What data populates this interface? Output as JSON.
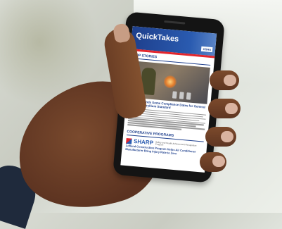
{
  "newsletter": {
    "brand": "QuickTakes",
    "org": "OSHA",
    "colors": {
      "brand_blue": "#1e3f8c",
      "accent_red": "#e3262d"
    }
  },
  "sections": {
    "top_stories": "TOP STORIES",
    "cooperative": "COOPERATIVE PROGRAMS"
  },
  "story1": {
    "title": "OSHA Extends Some Compliance Dates for General Industry Beryllium Standard"
  },
  "sharp": {
    "logo": "SHARP",
    "tagline": "Safety and Health Achievement Recognition Program",
    "story_title": "Lofland Construction Program Helps Air Conditioner Manufacturer Bring Injury Rate to Zero"
  }
}
